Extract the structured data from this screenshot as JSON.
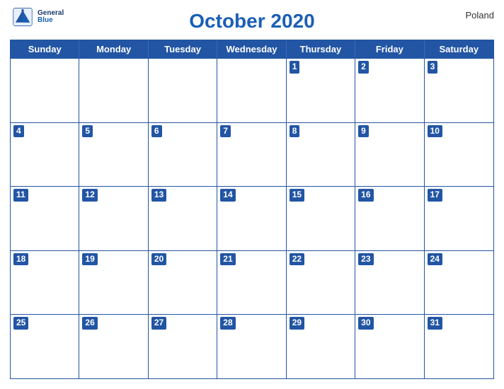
{
  "header": {
    "title": "October 2020",
    "country": "Poland",
    "logo_line1": "General",
    "logo_line2": "Blue"
  },
  "days_of_week": [
    "Sunday",
    "Monday",
    "Tuesday",
    "Wednesday",
    "Thursday",
    "Friday",
    "Saturday"
  ],
  "weeks": [
    [
      null,
      null,
      null,
      null,
      1,
      2,
      3
    ],
    [
      4,
      5,
      6,
      7,
      8,
      9,
      10
    ],
    [
      11,
      12,
      13,
      14,
      15,
      16,
      17
    ],
    [
      18,
      19,
      20,
      21,
      22,
      23,
      24
    ],
    [
      25,
      26,
      27,
      28,
      29,
      30,
      31
    ]
  ],
  "colors": {
    "header_blue": "#2255a4",
    "title_blue": "#1a5fb4"
  }
}
